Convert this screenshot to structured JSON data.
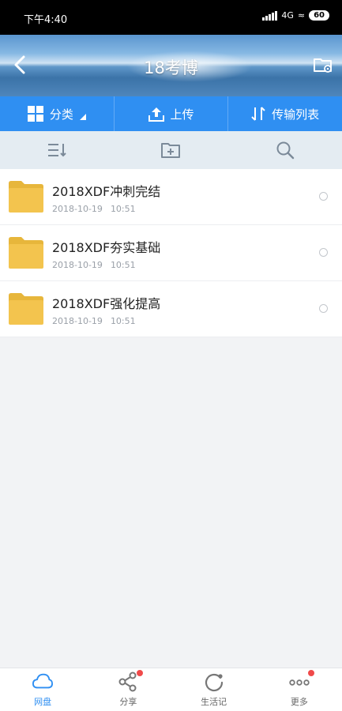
{
  "status_bar": {
    "time": "下午4:40",
    "network": "4G",
    "battery": "60"
  },
  "header": {
    "title": "18考博"
  },
  "actions": [
    {
      "label": "分类",
      "icon": "grid-icon"
    },
    {
      "label": "上传",
      "icon": "upload-icon"
    },
    {
      "label": "传输列表",
      "icon": "transfer-icon"
    }
  ],
  "toolbar": {
    "icons": [
      "sort-icon",
      "new-folder-icon",
      "search-icon"
    ]
  },
  "files": [
    {
      "name": "2018XDF冲刺完结",
      "date": "2018-10-19",
      "time": "10:51"
    },
    {
      "name": "2018XDF夯实基础",
      "date": "2018-10-19",
      "time": "10:51"
    },
    {
      "name": "2018XDF强化提高",
      "date": "2018-10-19",
      "time": "10:51"
    }
  ],
  "bottom_nav": [
    {
      "label": "网盘",
      "icon": "cloud-icon",
      "active": true,
      "badge": false
    },
    {
      "label": "分享",
      "icon": "share-icon",
      "active": false,
      "badge": true
    },
    {
      "label": "生活记",
      "icon": "refresh-icon",
      "active": false,
      "badge": false
    },
    {
      "label": "更多",
      "icon": "more-icon",
      "active": false,
      "badge": true
    }
  ],
  "colors": {
    "accent": "#2f8ff2",
    "folder": "#f3c44e",
    "badge": "#f04a4a",
    "toolbar_bg": "#e4ecf2"
  }
}
